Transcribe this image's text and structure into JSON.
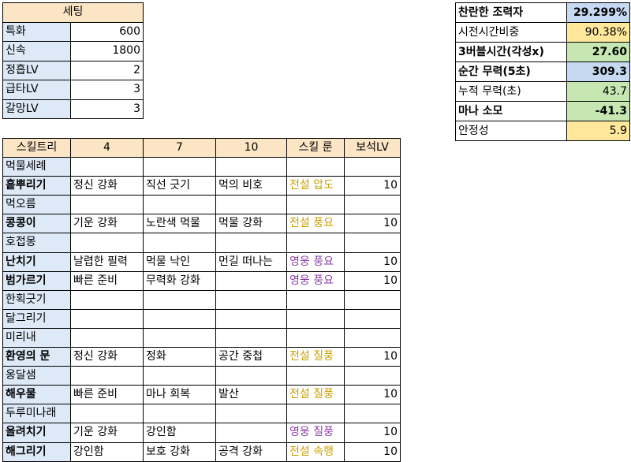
{
  "settings": {
    "title": "세팅",
    "rows": [
      {
        "label": "특화",
        "value": "600"
      },
      {
        "label": "신속",
        "value": "1800"
      },
      {
        "label": "정흡LV",
        "value": "2"
      },
      {
        "label": "급타LV",
        "value": "3"
      },
      {
        "label": "갈망LV",
        "value": "3"
      }
    ]
  },
  "stats": {
    "rows": [
      {
        "label": "찬란한 조력자",
        "value": "29.299%",
        "label_bold": true,
        "value_bold": true,
        "value_bg": "#c5d9f1"
      },
      {
        "label": "시전시간비중",
        "value": "90.38%",
        "label_bold": false,
        "value_bold": false,
        "value_bg": "#ffe79b"
      },
      {
        "label": "3버블시간(각성x)",
        "value": "27.60",
        "label_bold": true,
        "value_bold": true,
        "value_bg": "#c6e6b2"
      },
      {
        "label": "순간 무력(5초)",
        "value": "309.3",
        "label_bold": true,
        "value_bold": true,
        "value_bg": "#c5d9f1"
      },
      {
        "label": "누적 무력(초)",
        "value": "43.7",
        "label_bold": false,
        "value_bold": false,
        "value_bg": "#c6e6b2"
      },
      {
        "label": "마나 소모",
        "value": "-41.3",
        "label_bold": true,
        "value_bold": true,
        "value_bg": "#c6e6b2"
      },
      {
        "label": "안정성",
        "value": "5.9",
        "label_bold": false,
        "value_bold": false,
        "value_bg": "#ffe79b"
      }
    ]
  },
  "skill_tree": {
    "headers": [
      "스킬트리",
      "4",
      "7",
      "10",
      "스킬 룬",
      "보석LV"
    ],
    "rows": [
      {
        "name": "먹물세례",
        "bold": false,
        "t4": "",
        "t7": "",
        "t10": "",
        "rune": "",
        "rune_type": "",
        "gem": ""
      },
      {
        "name": "흩뿌리기",
        "bold": true,
        "t4": "정신 강화",
        "t7": "직선 긋기",
        "t10": "먹의 비호",
        "rune": "전설 압도",
        "rune_type": "legend",
        "gem": "10"
      },
      {
        "name": "먹오름",
        "bold": false,
        "t4": "",
        "t7": "",
        "t10": "",
        "rune": "",
        "rune_type": "",
        "gem": ""
      },
      {
        "name": "콩콩이",
        "bold": true,
        "t4": "기운 강화",
        "t7": "노란색 먹물",
        "t10": "먹물 강화",
        "rune": "전설 풍요",
        "rune_type": "legend",
        "gem": "10"
      },
      {
        "name": "호접몽",
        "bold": false,
        "t4": "",
        "t7": "",
        "t10": "",
        "rune": "",
        "rune_type": "",
        "gem": ""
      },
      {
        "name": "난치기",
        "bold": true,
        "t4": "날렵한 필력",
        "t7": "먹물 낙인",
        "t10": "먼길 떠나는",
        "rune": "영웅 풍요",
        "rune_type": "hero",
        "gem": "10"
      },
      {
        "name": "범가르기",
        "bold": true,
        "t4": "빠른 준비",
        "t7": "무력화 강화",
        "t10": "",
        "rune": "영웅 풍요",
        "rune_type": "hero",
        "gem": "10"
      },
      {
        "name": "한획긋기",
        "bold": false,
        "t4": "",
        "t7": "",
        "t10": "",
        "rune": "",
        "rune_type": "",
        "gem": ""
      },
      {
        "name": "달그리기",
        "bold": false,
        "t4": "",
        "t7": "",
        "t10": "",
        "rune": "",
        "rune_type": "",
        "gem": ""
      },
      {
        "name": "미리내",
        "bold": false,
        "t4": "",
        "t7": "",
        "t10": "",
        "rune": "",
        "rune_type": "",
        "gem": ""
      },
      {
        "name": "환영의 문",
        "bold": true,
        "t4": "정신 강화",
        "t7": "정화",
        "t10": "공간 중첩",
        "rune": "전설 질풍",
        "rune_type": "legend",
        "gem": "10"
      },
      {
        "name": "옹달샘",
        "bold": false,
        "t4": "",
        "t7": "",
        "t10": "",
        "rune": "",
        "rune_type": "",
        "gem": ""
      },
      {
        "name": "해우물",
        "bold": true,
        "t4": "빠른 준비",
        "t7": "마나 회복",
        "t10": "발산",
        "rune": "전설 질풍",
        "rune_type": "legend",
        "gem": "10"
      },
      {
        "name": "두루미나래",
        "bold": false,
        "t4": "",
        "t7": "",
        "t10": "",
        "rune": "",
        "rune_type": "",
        "gem": ""
      },
      {
        "name": "올려치기",
        "bold": true,
        "t4": "기운 강화",
        "t7": "강인함",
        "t10": "",
        "rune": "영웅 질풍",
        "rune_type": "hero",
        "gem": "10"
      },
      {
        "name": "해그리기",
        "bold": true,
        "t4": "강인함",
        "t7": "보호 강화",
        "t10": "공격 강화",
        "rune": "전설 속행",
        "rune_type": "legend",
        "gem": "10"
      }
    ]
  }
}
